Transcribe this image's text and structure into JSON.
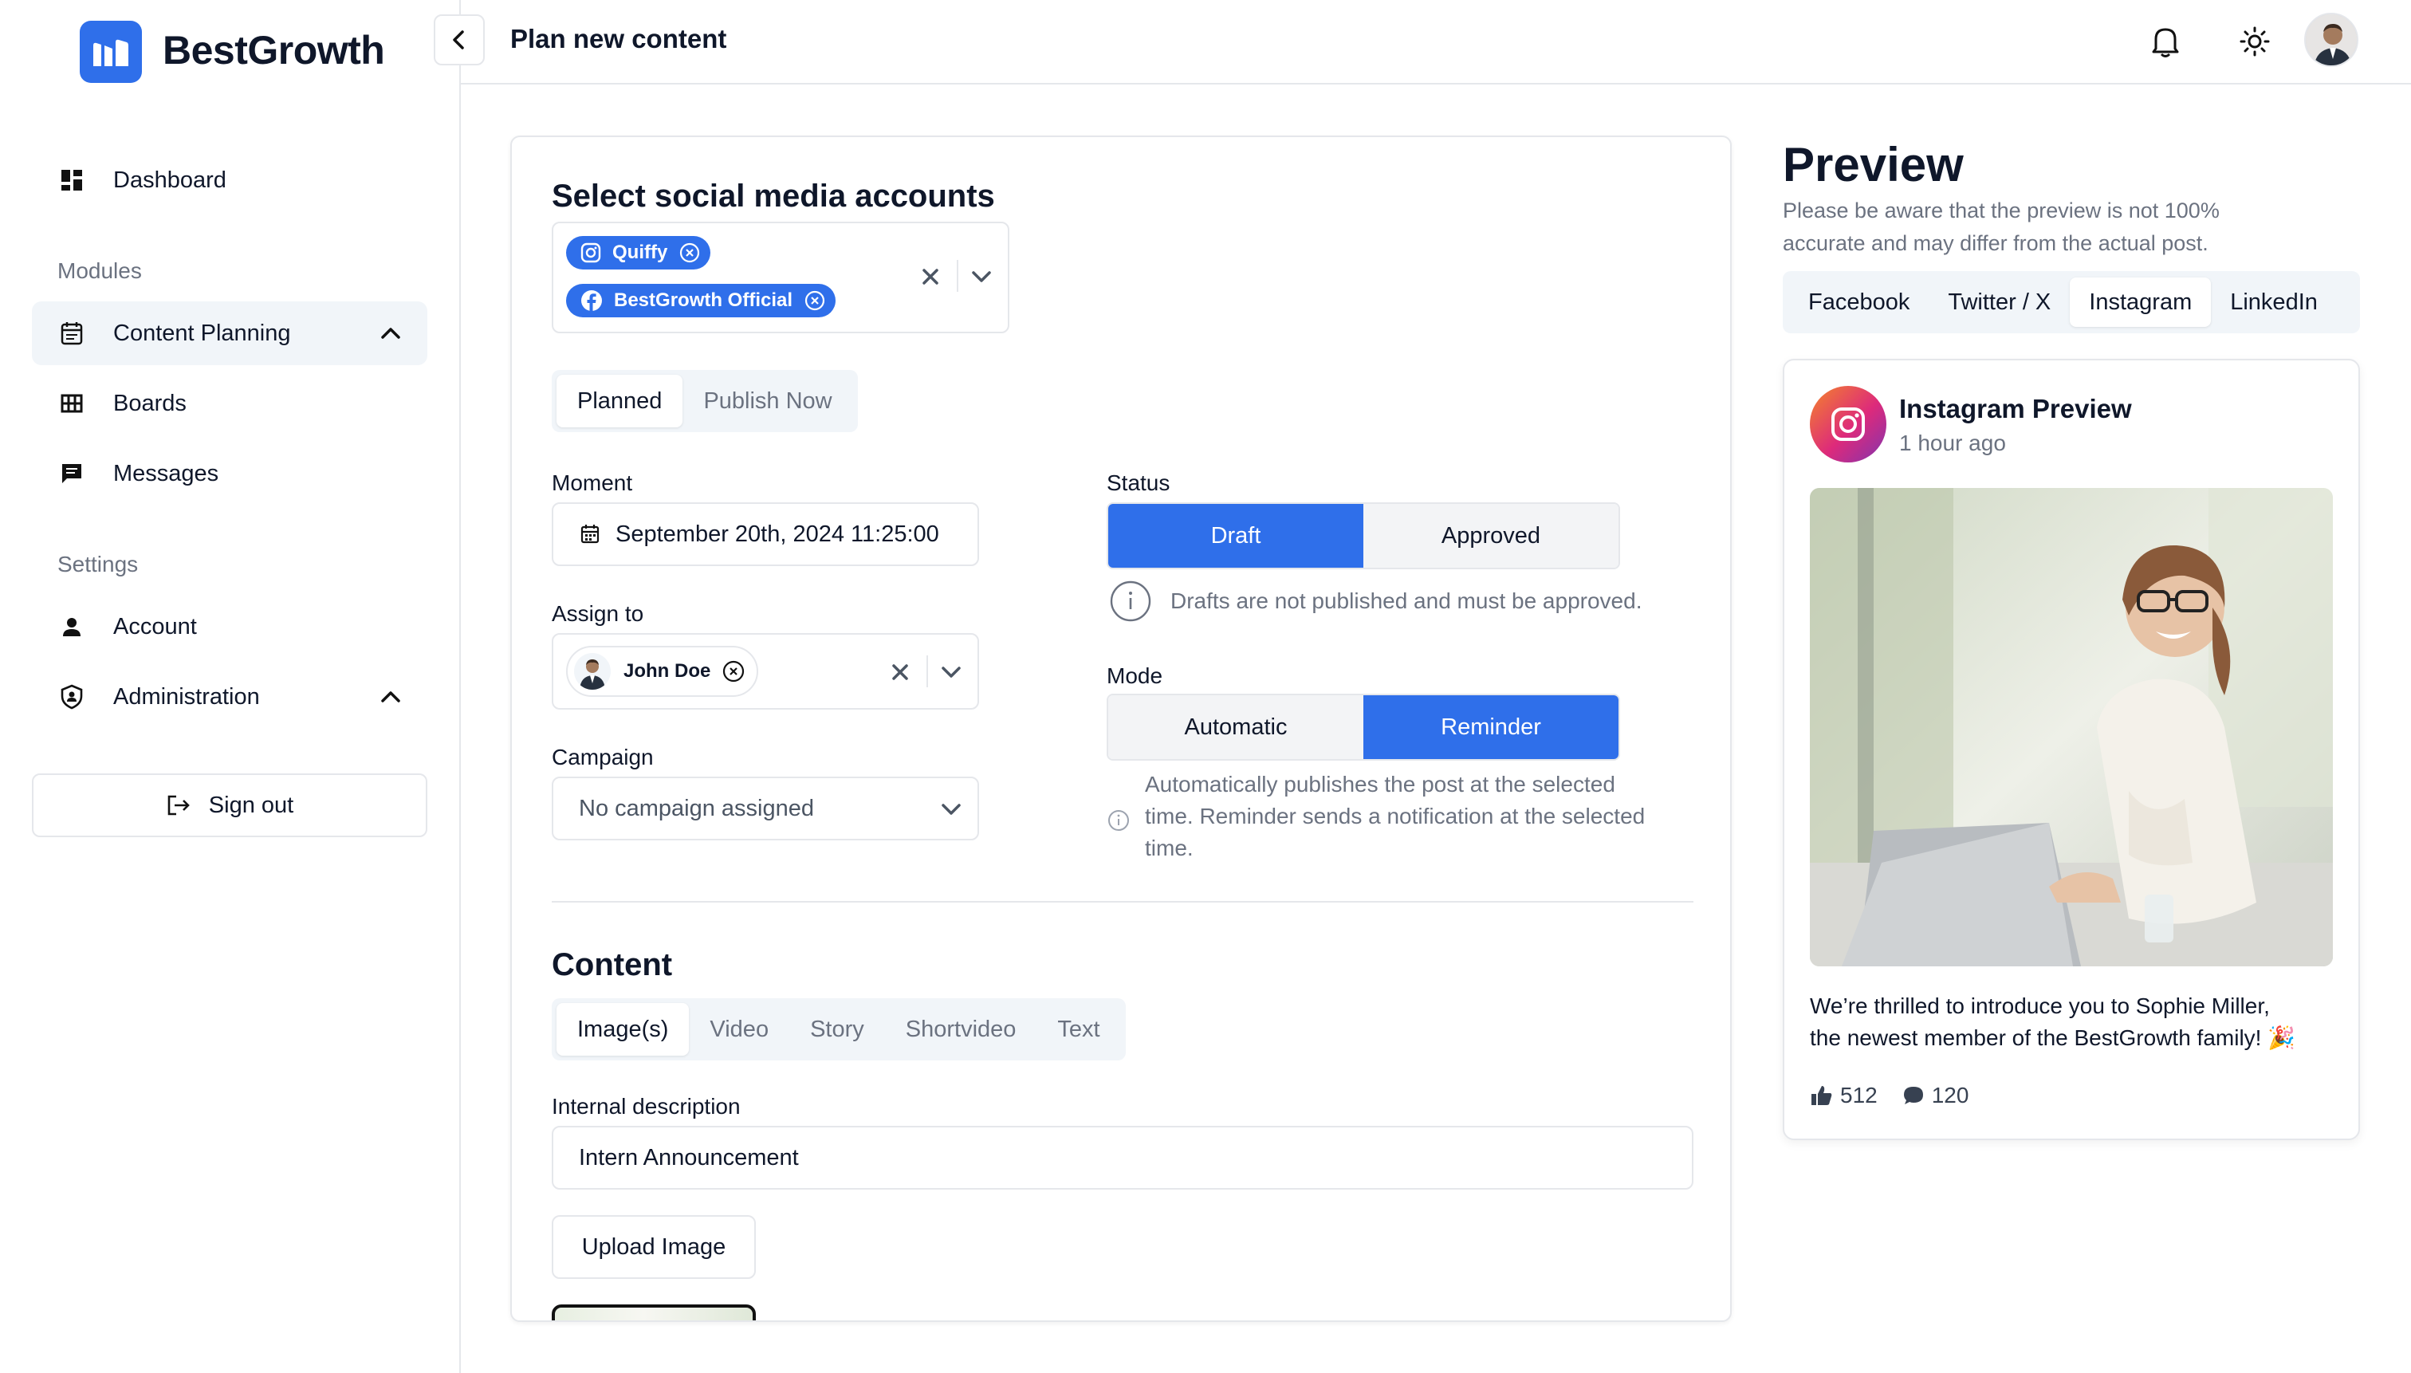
{
  "app": {
    "brand": "BestGrowth",
    "accent": "#2f6fea"
  },
  "sidebar": {
    "dashboard": "Dashboard",
    "modules_label": "Modules",
    "content_planning": "Content Planning",
    "boards": "Boards",
    "messages": "Messages",
    "settings_label": "Settings",
    "account": "Account",
    "administration": "Administration",
    "sign_out": "Sign out"
  },
  "header": {
    "title": "Plan new content"
  },
  "form": {
    "accounts_title": "Select social media accounts",
    "accounts": [
      {
        "name": "Quiffy",
        "icon": "instagram-icon"
      },
      {
        "name": "BestGrowth Official",
        "icon": "facebook-icon"
      }
    ],
    "schedule_tabs": [
      "Planned",
      "Publish Now"
    ],
    "schedule_selected": "Planned",
    "moment_label": "Moment",
    "moment_value": "September 20th, 2024 11:25:00",
    "assign_label": "Assign to",
    "assignee": "John Doe",
    "campaign_label": "Campaign",
    "campaign_value": "No campaign assigned",
    "status_label": "Status",
    "status_options": [
      "Draft",
      "Approved"
    ],
    "status_selected": "Draft",
    "status_hint": "Drafts are not published and must be approved.",
    "mode_label": "Mode",
    "mode_options": [
      "Automatic",
      "Reminder"
    ],
    "mode_selected": "Reminder",
    "mode_hint_1": "Automatically publishes the post at the selected",
    "mode_hint_2": "time. Reminder sends a notification at the selected",
    "mode_hint_3": "time.",
    "content_title": "Content",
    "content_tabs": [
      "Image(s)",
      "Video",
      "Story",
      "Shortvideo",
      "Text"
    ],
    "content_selected": "Image(s)",
    "internal_desc_label": "Internal description",
    "internal_desc_value": "Intern Announcement",
    "upload_label": "Upload Image"
  },
  "preview": {
    "title": "Preview",
    "note_1": "Please be aware that the preview is not 100%",
    "note_2": "accurate and may differ from the actual post.",
    "tabs": [
      "Facebook",
      "Twitter / X",
      "Instagram",
      "LinkedIn"
    ],
    "selected_tab": "Instagram",
    "card_title": "Instagram Preview",
    "card_time": "1 hour ago",
    "caption_1": "We’re thrilled to introduce you to Sophie Miller,",
    "caption_2": "the newest member of the BestGrowth family! 🎉",
    "likes": "512",
    "comments": "120"
  }
}
